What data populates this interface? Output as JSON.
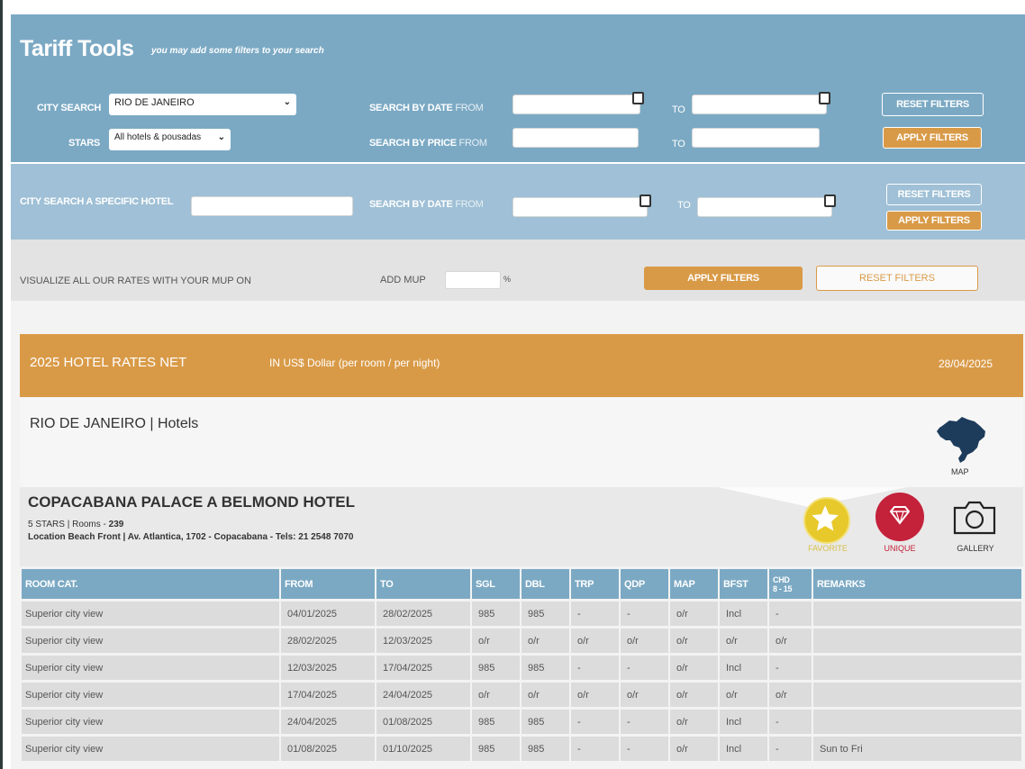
{
  "header": {
    "title": "Tariff Tools",
    "subtitle": "you may add some filters to your search"
  },
  "filters1": {
    "city_label": "CITY SEARCH",
    "city_value": "RIO DE JANEIRO",
    "stars_label": "STARS",
    "stars_value": "All hotels & pousadas",
    "date_label_bold": "SEARCH BY DATE",
    "date_label_light": "FROM",
    "price_label_bold": "SEARCH BY PRICE",
    "price_label_light": "FROM",
    "to_label": "TO",
    "reset_label": "RESET FILTERS",
    "apply_label": "APPLY FILTERS"
  },
  "filters2": {
    "hotel_label": "CITY SEARCH A SPECIFIC HOTEL",
    "date_label_bold": "SEARCH BY DATE",
    "date_label_light": "FROM",
    "to_label": "TO",
    "reset_label": "RESET FILTERS",
    "apply_label": "APPLY FILTERS"
  },
  "mup": {
    "visualize_label": "VISUALIZE ALL OUR RATES WITH YOUR MUP ON",
    "add_label": "ADD MUP",
    "percent": "%",
    "apply_label": "APPLY FILTERS",
    "reset_label": "RESET FILTERS"
  },
  "rates": {
    "title": "2025 HOTEL RATES NET",
    "currency": "IN US$ Dollar (per room / per night)",
    "date": "28/04/2025"
  },
  "city": {
    "title": "RIO DE JANEIRO | Hotels",
    "map_label": "MAP"
  },
  "hotel": {
    "name": "COPACABANA PALACE A BELMOND HOTEL",
    "stars_text": "5 STARS | Rooms - ",
    "rooms": "239",
    "location": "Location Beach Front  |   Av. Atlantica, 1702 - Copacabana - Tels: 21 2548 7070",
    "favorite_label": "FAVORITE",
    "unique_label": "UNIQUE",
    "gallery_label": "GALLERY",
    "colors": {
      "favorite": "#e8c92b",
      "unique": "#c4213a"
    }
  },
  "table": {
    "headers": [
      "ROOM CAT.",
      "FROM",
      "TO",
      "SGL",
      "DBL",
      "TRP",
      "QDP",
      "MAP",
      "BFST",
      "CHD",
      "REMARKS"
    ],
    "chd_sub": "8 - 15",
    "rows": [
      [
        "Superior city view",
        "04/01/2025",
        "28/02/2025",
        "985",
        "985",
        "-",
        "-",
        "o/r",
        "Incl",
        "-",
        ""
      ],
      [
        "Superior city view",
        "28/02/2025",
        "12/03/2025",
        "o/r",
        "o/r",
        "o/r",
        "o/r",
        "o/r",
        "o/r",
        "o/r",
        ""
      ],
      [
        "Superior city view",
        "12/03/2025",
        "17/04/2025",
        "985",
        "985",
        "-",
        "-",
        "o/r",
        "Incl",
        "-",
        ""
      ],
      [
        "Superior city view",
        "17/04/2025",
        "24/04/2025",
        "o/r",
        "o/r",
        "o/r",
        "o/r",
        "o/r",
        "o/r",
        "o/r",
        ""
      ],
      [
        "Superior city view",
        "24/04/2025",
        "01/08/2025",
        "985",
        "985",
        "-",
        "-",
        "o/r",
        "Incl",
        "-",
        ""
      ],
      [
        "Superior city view",
        "01/08/2025",
        "01/10/2025",
        "985",
        "985",
        "-",
        "-",
        "o/r",
        "Incl",
        "-",
        "Sun to Fri"
      ]
    ]
  },
  "theme": {
    "band_blue": "#7ba9c4",
    "band_light_blue": "#9fc0d6",
    "accent_orange": "#d99a47"
  }
}
